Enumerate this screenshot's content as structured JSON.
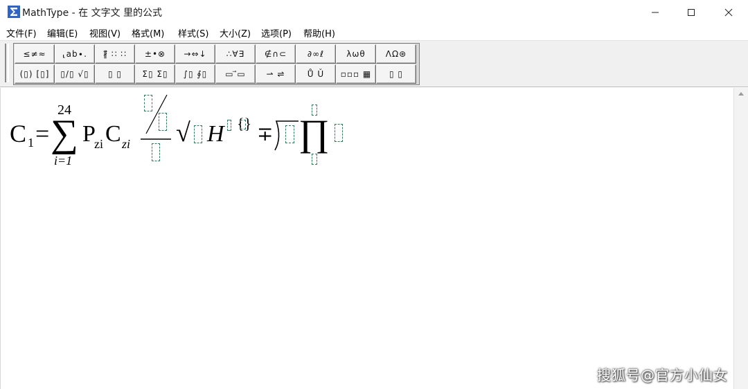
{
  "window": {
    "title": "MathType - 在 文字文 里的公式",
    "minimize_glyph": "—",
    "maximize_glyph": "☐",
    "close_glyph": "✕"
  },
  "menu": {
    "items": [
      {
        "label": "文件(F)"
      },
      {
        "label": "编辑(E)"
      },
      {
        "label": "视图(V)"
      },
      {
        "label": "格式(M)"
      },
      {
        "label": "样式(S)"
      },
      {
        "label": "大小(Z)"
      },
      {
        "label": "选项(P)"
      },
      {
        "label": "帮助(H)"
      }
    ]
  },
  "toolbar": {
    "row1": [
      {
        "label": "≤≠≈",
        "icon": "relations-palette-icon"
      },
      {
        "label": "⸤ab∙.",
        "icon": "spaces-ellipses-palette-icon"
      },
      {
        "label": "∦⃗ ∷ ∷",
        "icon": "embellishments-palette-icon"
      },
      {
        "label": "±•⊗",
        "icon": "operators-palette-icon"
      },
      {
        "label": "→⇔↓",
        "icon": "arrows-palette-icon"
      },
      {
        "label": "∴∀∃",
        "icon": "logic-palette-icon"
      },
      {
        "label": "∉∩⊂",
        "icon": "set-theory-palette-icon"
      },
      {
        "label": "∂∞ℓ",
        "icon": "misc-symbols-palette-icon"
      },
      {
        "label": "λωθ",
        "icon": "greek-lower-palette-icon"
      },
      {
        "label": "ΛΩ⊛",
        "icon": "greek-upper-palette-icon"
      }
    ],
    "row2": [
      {
        "label": "(▯) [▯]",
        "icon": "fences-palette-icon"
      },
      {
        "label": "▯/▯ √▯",
        "icon": "fractions-radicals-palette-icon"
      },
      {
        "label": "▯ ▯",
        "icon": "subscript-superscript-palette-icon"
      },
      {
        "label": "Σ▯ Σ▯",
        "icon": "summations-palette-icon"
      },
      {
        "label": "∫▯ ∮▯",
        "icon": "integrals-palette-icon"
      },
      {
        "label": "▭ ⃗▭",
        "icon": "underbar-overbar-palette-icon"
      },
      {
        "label": "⇀ ⇌",
        "icon": "labeled-arrows-palette-icon"
      },
      {
        "label": "Ů Ǔ",
        "icon": "products-set-palette-icon"
      },
      {
        "label": "▫▫▫ ▦",
        "icon": "matrices-palette-icon"
      },
      {
        "label": "▯ ▯",
        "icon": "boxes-palette-icon"
      }
    ]
  },
  "formula": {
    "c": "C",
    "c_sub": "1",
    "equals": "=",
    "sigma": "∑",
    "sigma_upper": "24",
    "sigma_lower": "i=1",
    "p": "P",
    "p_sub": "zi",
    "c2": "C",
    "c2_sub": "zi",
    "radical": "√",
    "h": "H",
    "brace_slot": "{}",
    "mp": "∓",
    "prod": "∏"
  },
  "watermark": "搜狐号@官方小仙女"
}
